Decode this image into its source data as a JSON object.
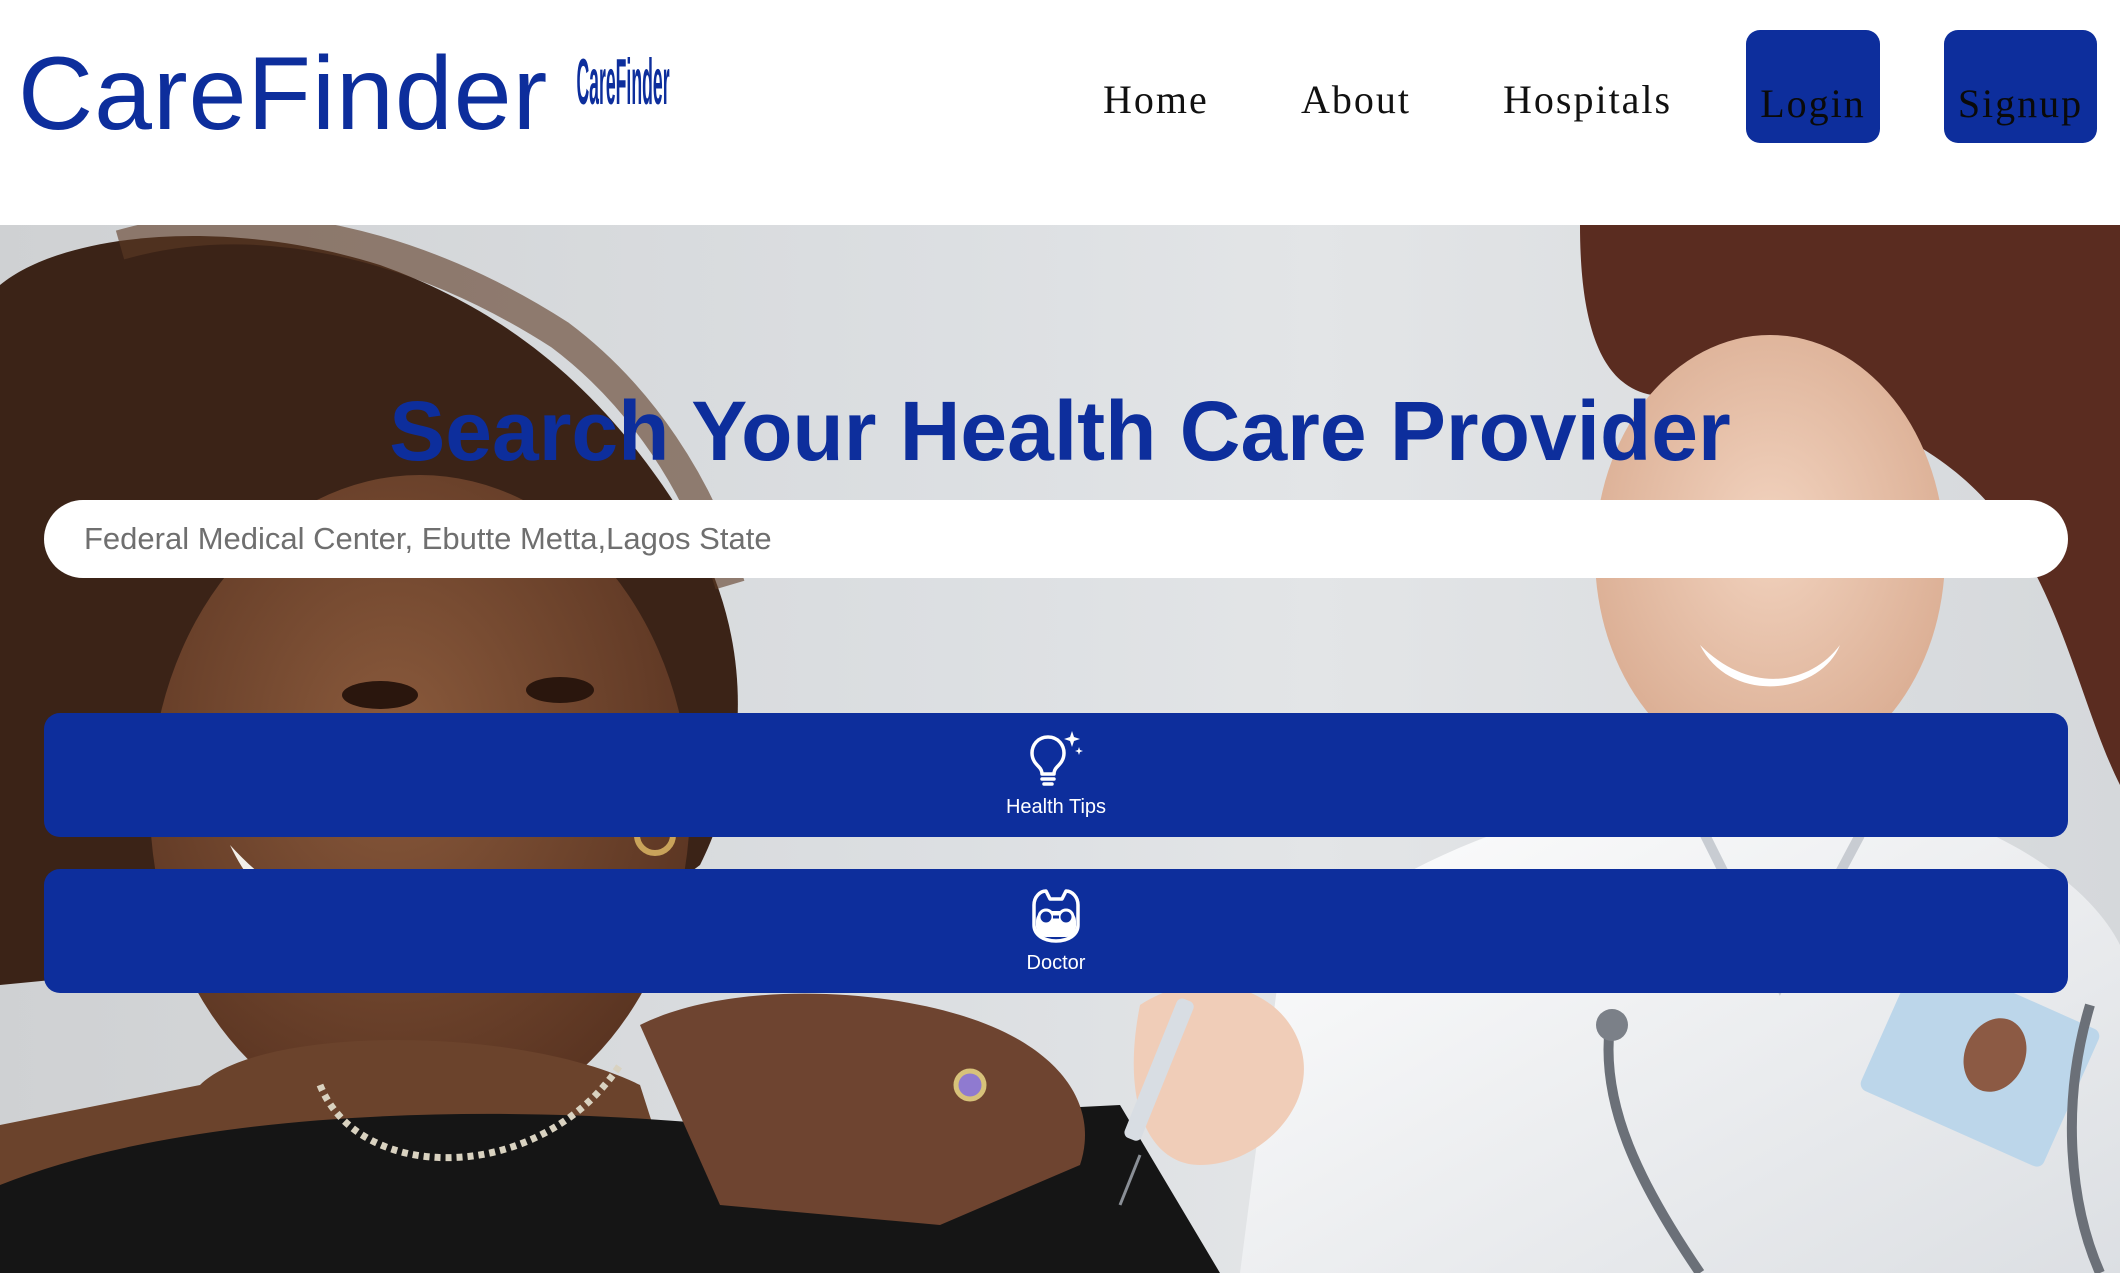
{
  "brand": {
    "name": "CareFinder",
    "logo_text": "CareFinder"
  },
  "nav": {
    "links": [
      {
        "label": "Home"
      },
      {
        "label": "About"
      },
      {
        "label": "Hospitals"
      }
    ],
    "login_label": "Login",
    "signup_label": "Signup"
  },
  "hero": {
    "title": "Search Your Health Care Provider",
    "search": {
      "placeholder": "Federal Medical Center, Ebutte Metta,Lagos State",
      "value": ""
    },
    "cards": [
      {
        "label": "Health Tips",
        "icon": "lightbulb-sparkle-icon"
      },
      {
        "label": "Doctor",
        "icon": "doctor-icon"
      }
    ]
  },
  "colors": {
    "brand_blue": "#0d2e9c",
    "white": "#ffffff",
    "nav_text": "#111111"
  }
}
